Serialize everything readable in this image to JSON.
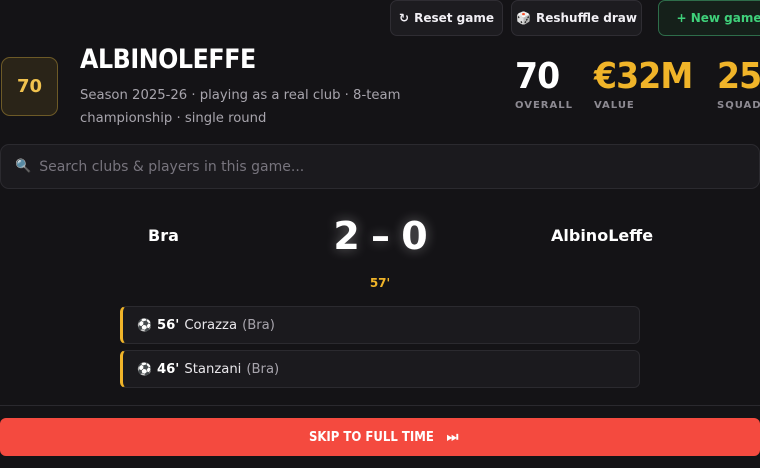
{
  "toolbar": {
    "reset_label": "Reset game",
    "reset_icon": "↻",
    "reshuffle_label": "Reshuffle draw",
    "reshuffle_icon": "🎲",
    "new_game_label": "+ New game"
  },
  "club": {
    "rating_badge": "70",
    "name": "ALBINOLEFFE",
    "subtitle": "Season 2025-26 · playing as a real club · 8-team championship · single round"
  },
  "stats": [
    {
      "value": "70",
      "label": "OVERALL"
    },
    {
      "value": "€32M",
      "label": "VALUE"
    },
    {
      "value": "25",
      "label": "SQUAD"
    }
  ],
  "search": {
    "icon": "🔍",
    "placeholder": "Search clubs & players in this game..."
  },
  "match": {
    "home_team": "Bra",
    "away_team": "AlbinoLeffe",
    "score": "2 – 0",
    "minute": "57'"
  },
  "events": [
    {
      "icon": "⚽",
      "minute": "56'",
      "player": "Corazza",
      "team": "(Bra)"
    },
    {
      "icon": "⚽",
      "minute": "46'",
      "player": "Stanzani",
      "team": "(Bra)"
    }
  ],
  "skip": {
    "label": "SKIP TO FULL TIME",
    "icon": "⏭"
  },
  "colors": {
    "accent_gold": "#f0b429",
    "skip_red": "#f44a3f",
    "new_game_green": "#3fd07a"
  }
}
